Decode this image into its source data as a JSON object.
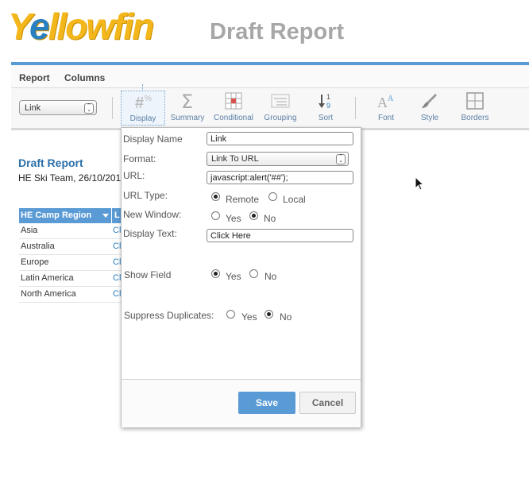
{
  "app": {
    "logo_text_a": "Y",
    "logo_text_b": "e",
    "logo_text_c": "llowfin",
    "page_title": "Draft Report"
  },
  "nav": {
    "report": "Report",
    "columns": "Columns"
  },
  "toolbar": {
    "field_select_value": "Link",
    "buttons": [
      {
        "label": "Display",
        "icon": "hash-percent-icon"
      },
      {
        "label": "Summary",
        "icon": "sigma-icon"
      },
      {
        "label": "Conditional",
        "icon": "conditional-grid-icon"
      },
      {
        "label": "Grouping",
        "icon": "grouping-lines-icon"
      },
      {
        "label": "Sort",
        "icon": "sort-icon"
      },
      {
        "label": "Font",
        "icon": "font-icon"
      },
      {
        "label": "Style",
        "icon": "brush-icon"
      },
      {
        "label": "Borders",
        "icon": "borders-icon"
      }
    ]
  },
  "report": {
    "title": "Draft Report",
    "subtitle": "HE Ski Team, 26/10/201",
    "column_header": "HE Camp Region",
    "column2_header": "L",
    "rows": [
      {
        "region": "Asia",
        "link": "Cl"
      },
      {
        "region": "Australia",
        "link": "Cl"
      },
      {
        "region": "Europe",
        "link": "Cl"
      },
      {
        "region": "Latin America",
        "link": "Cl"
      },
      {
        "region": "North America",
        "link": "Cl"
      }
    ]
  },
  "dialog": {
    "display_name_label": "Display Name",
    "display_name_value": "Link",
    "format_label": "Format:",
    "format_value": "Link To URL",
    "url_label": "URL:",
    "url_value": "javascript:alert('##');",
    "url_type_label": "URL Type:",
    "url_type_options": [
      "Remote",
      "Local"
    ],
    "url_type_selected": "Remote",
    "new_window_label": "New Window:",
    "new_window_options": [
      "Yes",
      "No"
    ],
    "new_window_selected": "No",
    "display_text_label": "Display Text:",
    "display_text_value": "Click Here",
    "show_field_label": "Show Field",
    "show_field_options": [
      "Yes",
      "No"
    ],
    "show_field_selected": "Yes",
    "suppress_label": "Suppress Duplicates:",
    "suppress_options": [
      "Yes",
      "No"
    ],
    "suppress_selected": "No",
    "save_label": "Save",
    "cancel_label": "Cancel"
  },
  "colors": {
    "accent": "#5b9bd5",
    "logo_yellow": "#f4b71b",
    "logo_blue": "#2a7fc0"
  }
}
